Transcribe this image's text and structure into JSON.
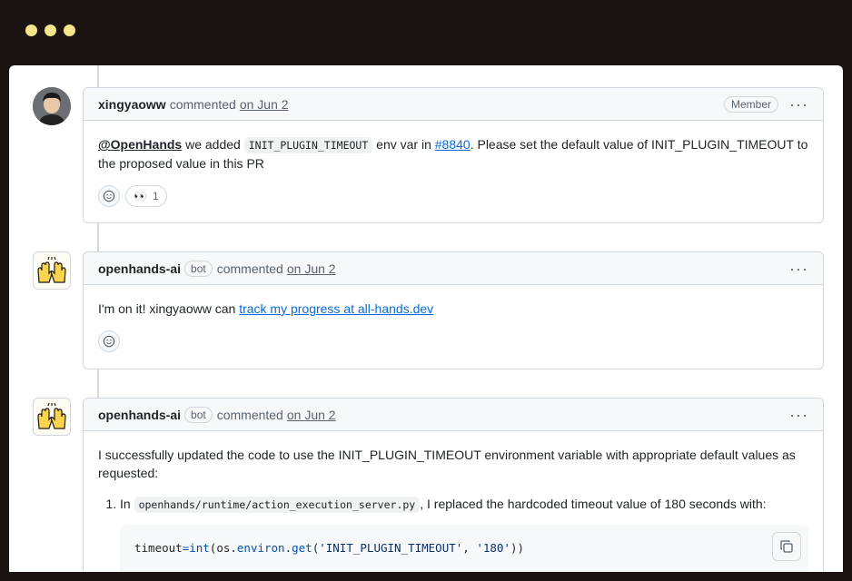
{
  "comments": [
    {
      "author": "xingyaoww",
      "action": "commented",
      "date": "on Jun 2",
      "role": "Member",
      "menu": "···",
      "body": {
        "mention": "@OpenHands",
        "t1": " we added ",
        "code": "INIT_PLUGIN_TIMEOUT",
        "t2": " env var in ",
        "link": "#8840",
        "t3": ". Please set the default value of INIT_PLUGIN_TIMEOUT to the proposed value in this PR"
      },
      "reaction": {
        "emoji": "👀",
        "count": "1"
      }
    },
    {
      "author": "openhands-ai",
      "bot_label": "bot",
      "action": "commented",
      "date": "on Jun 2",
      "menu": "···",
      "body": {
        "t1": "I'm on it! xingyaoww can ",
        "link": "track my progress at all-hands.dev"
      }
    },
    {
      "author": "openhands-ai",
      "bot_label": "bot",
      "action": "commented",
      "date": "on Jun 2",
      "menu": "···",
      "body": {
        "intro": "I successfully updated the code to use the INIT_PLUGIN_TIMEOUT environment variable with appropriate default values as requested:",
        "item1_pre": "In ",
        "item1_code": "openhands/runtime/action_execution_server.py",
        "item1_post": ", I replaced the hardcoded timeout value of 180 seconds with:",
        "code_block": {
          "var": "timeout",
          "eq": "=",
          "fn1": "int",
          "p1": "(os.",
          "attr": "environ",
          "dot": ".",
          "fn2": "get",
          "p2": "(",
          "s1": "'INIT_PLUGIN_TIMEOUT'",
          "comma": ", ",
          "s2": "'180'",
          "p3": "))"
        }
      }
    }
  ],
  "icons": {
    "window_dots": "traffic-light-dots",
    "add_reaction": "smiley-icon",
    "bot_avatar": "raised-hands-icon",
    "copy": "copy-icon"
  }
}
